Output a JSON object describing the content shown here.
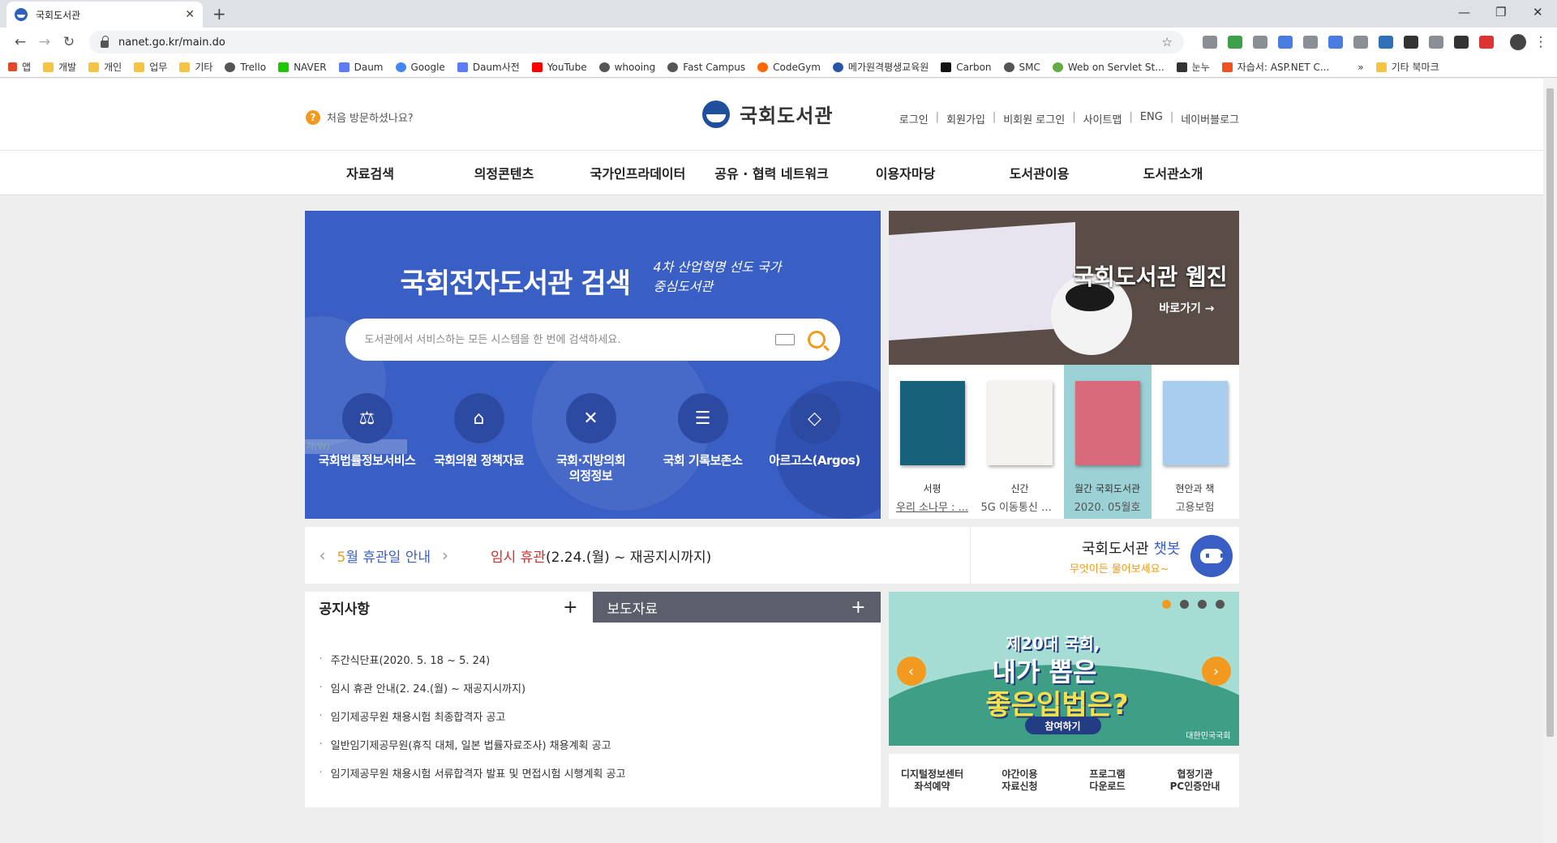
{
  "browser": {
    "tab_title": "국회도서관",
    "url": "nanet.go.kr/main.do",
    "bookmarks": [
      "앱",
      "개발",
      "개인",
      "업무",
      "기타",
      "Trello",
      "NAVER",
      "Daum",
      "Google",
      "Daum사전",
      "YouTube",
      "whooing",
      "Fast Campus",
      "CodeGym",
      "메가원격평생교육원",
      "Carbon",
      "SMC",
      "Web on Servlet St...",
      "눈누",
      "자습서: ASP.NET C..."
    ],
    "more": "»",
    "other_bookmarks": "기타 북마크"
  },
  "header": {
    "first_visit": "처음 방문하셨나요?",
    "logo_text": "국회도서관",
    "util_links": [
      "로그인",
      "회원가입",
      "비회원 로그인",
      "사이트맵",
      "ENG",
      "네이버블로그"
    ]
  },
  "gnb": [
    "자료검색",
    "의정콘텐츠",
    "국가인프라데이터",
    "공유 · 협력 네트워크",
    "이용자마당",
    "도서관이용",
    "도서관소개"
  ],
  "search": {
    "title": "국회전자도서관 검색",
    "slogan": "4차 산업혁명 선도 국가중심도서관",
    "placeholder": "도서관에서 서비스하는 모든 시스템을 한 번에 검색하세요."
  },
  "services": [
    {
      "label": "국회법률정보서비스",
      "icon": "gavel-icon"
    },
    {
      "label": "국회의원 정책자료",
      "icon": "building-icon"
    },
    {
      "label": "국회·지방의회 의정정보",
      "icon": "network-icon"
    },
    {
      "label": "국회 기록보존소",
      "icon": "archive-icon"
    },
    {
      "label": "아르고스(Argos)",
      "icon": "cube-icon"
    }
  ],
  "capture_hint": "창 캡처(W)",
  "webzine": {
    "title": "국회도서관 웹진",
    "link": "바로가기 →"
  },
  "books": [
    {
      "category": "서평",
      "title": "우리 소나무 : ..."
    },
    {
      "category": "신간",
      "title": "5G 이동통신 비..."
    },
    {
      "category": "월간 국회도서관",
      "title": "2020. 05월호"
    },
    {
      "category": "현안과 책",
      "title": "고용보험"
    }
  ],
  "holiday": {
    "month_num": "5",
    "month_text": "월 휴관일 안내",
    "notice_red": "임시 휴관",
    "notice_rest": "(2.24.(월) ~ 재공지시까지)"
  },
  "chatbot": {
    "title_main": "국회도서관 ",
    "title_accent": "챗봇",
    "subtitle": "무엇이든 물어보세요~"
  },
  "notice": {
    "tab_notice": "공지사항",
    "tab_press": "보도자료",
    "plus": "+",
    "items": [
      "주간식단표(2020. 5. 18 ~ 5. 24)",
      "임시 휴관 안내(2. 24.(월) ~ 재공지시까지)",
      "임기제공무원 채용시험 최종합격자 공고",
      "일반임기제공무원(휴직 대체, 일본 법률자료조사) 채용계획 공고",
      "임기제공무원 채용시험 서류합격자 발표 및 면접시험 시행계획 공고"
    ]
  },
  "banner": {
    "line1": "제20대 국회,",
    "line2": "내가 뽑은",
    "line3": "좋은입법은?",
    "cta": "참여하기",
    "org": "대한민국국회"
  },
  "quicklinks": [
    "디지털정보센터\n좌석예약",
    "야간이용\n자료신청",
    "프로그램\n다운로드",
    "협정기관\nPC인증안내"
  ],
  "colors": {
    "primary": "#3a5fc4",
    "accent": "#f29a1f",
    "alert": "#d62b2b"
  }
}
